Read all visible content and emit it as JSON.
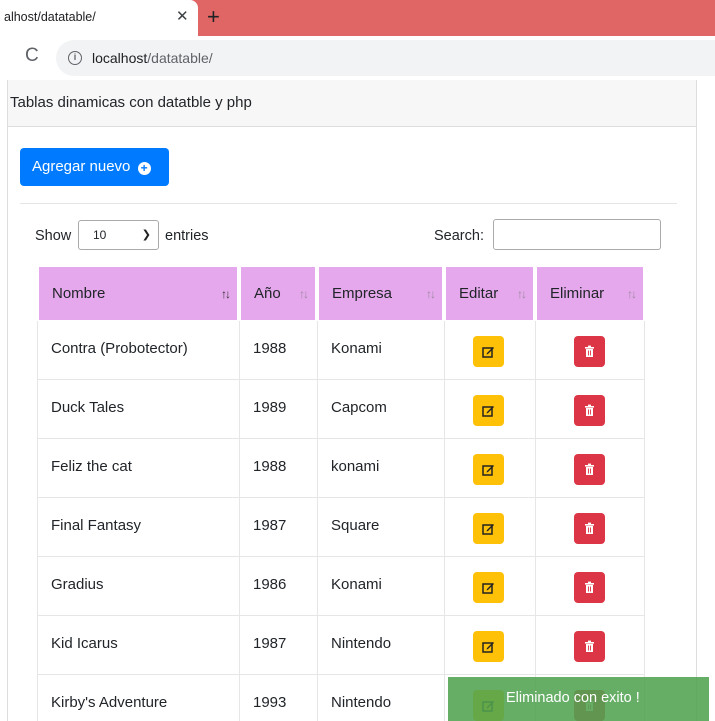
{
  "browser": {
    "tab_title": "alhost/datatable/",
    "close_symbol": "✕",
    "new_tab_symbol": "+",
    "reload_symbol": "C",
    "info_symbol": "i",
    "url_host": "localhost",
    "url_path": "/datatable/"
  },
  "page": {
    "header_title": "Tablas dinamicas con datatble y php",
    "add_button_label": "Agregar nuevo",
    "add_button_icon": "plus-circle-icon"
  },
  "controls": {
    "show_label": "Show",
    "entries_value": "10",
    "entries_label": "entries",
    "search_label": "Search:",
    "search_value": ""
  },
  "table": {
    "columns": [
      "Nombre",
      "Año",
      "Empresa",
      "Editar",
      "Eliminar"
    ],
    "sorted_column": "Nombre",
    "rows": [
      {
        "nombre": "Contra (Probotector)",
        "anio": "1988",
        "empresa": "Konami"
      },
      {
        "nombre": "Duck Tales",
        "anio": "1989",
        "empresa": "Capcom"
      },
      {
        "nombre": "Feliz the cat",
        "anio": "1988",
        "empresa": "konami"
      },
      {
        "nombre": "Final Fantasy",
        "anio": "1987",
        "empresa": "Square"
      },
      {
        "nombre": "Gradius",
        "anio": "1986",
        "empresa": "Konami"
      },
      {
        "nombre": "Kid Icarus",
        "anio": "1987",
        "empresa": "Nintendo"
      },
      {
        "nombre": "Kirby's Adventure",
        "anio": "1993",
        "empresa": "Nintendo"
      }
    ]
  },
  "toast": {
    "message": "Eliminado con exito !"
  },
  "colors": {
    "tab_strip": "#e06666",
    "primary": "#007bff",
    "header_bg": "#e5a8ec",
    "edit_btn": "#ffc107",
    "delete_btn": "#dc3545",
    "toast_bg": "#51a351"
  }
}
